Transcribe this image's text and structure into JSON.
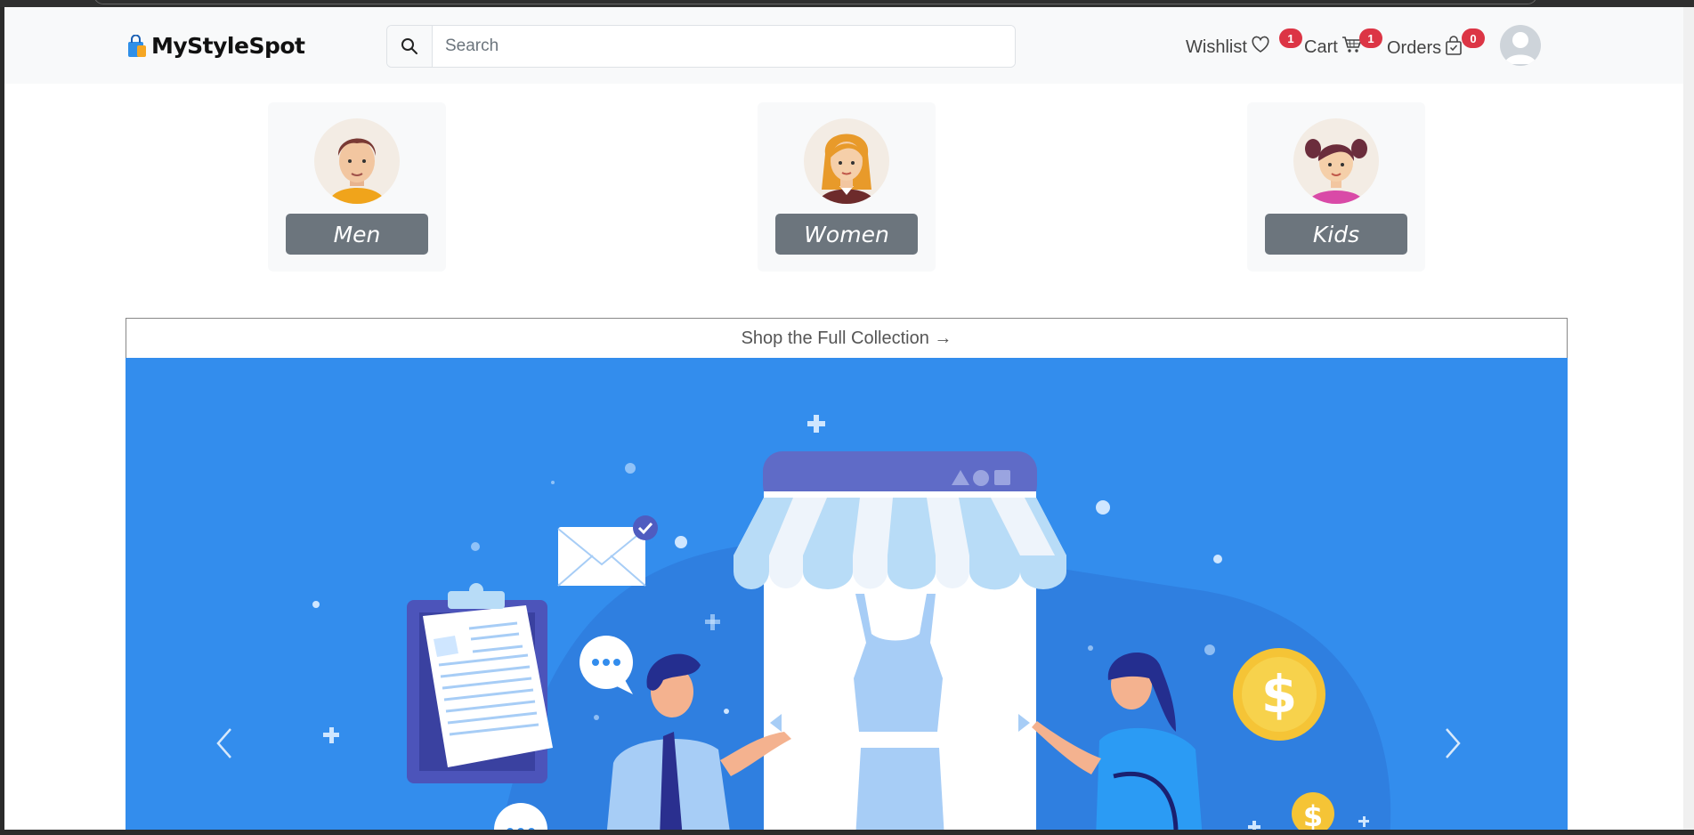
{
  "navbar": {
    "brand_name": "MyStyleSpot",
    "brand_icon": "shopping-bag-icon",
    "search": {
      "placeholder": "Search",
      "value": "",
      "icon": "search-icon"
    },
    "items": [
      {
        "label": "Wishlist",
        "icon": "heart-icon",
        "count": "1"
      },
      {
        "label": "Cart",
        "icon": "cart-icon",
        "count": "1"
      },
      {
        "label": "Orders",
        "icon": "bag-check-icon",
        "count": "0"
      }
    ],
    "badge_color": "#dc3545",
    "avatar_icon": "user-avatar-icon"
  },
  "categories": [
    {
      "label": "Men",
      "icon": "man-avatar-icon"
    },
    {
      "label": "Women",
      "icon": "woman-avatar-icon"
    },
    {
      "label": "Kids",
      "icon": "girl-avatar-icon"
    }
  ],
  "collection": {
    "link_text": "Shop the Full Collection →"
  },
  "carousel": {
    "prev_icon": "chevron-left-icon",
    "next_icon": "chevron-right-icon",
    "slide_description_icon": "online-store-illustration",
    "background_color": "#338ded"
  }
}
